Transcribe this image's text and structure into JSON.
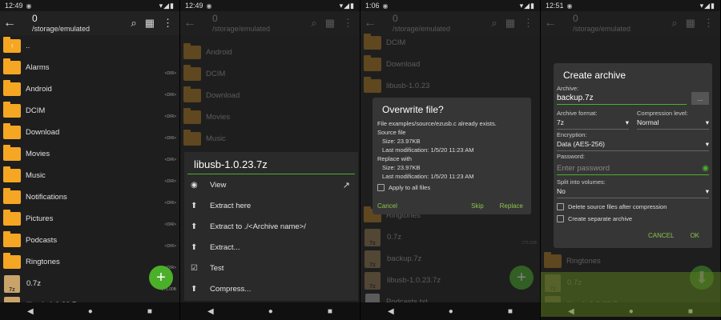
{
  "panels": [
    {
      "status": {
        "time": "12:49"
      },
      "toolbar": {
        "count": "0",
        "path": "/storage/emulated"
      }
    },
    {
      "status": {
        "time": "12:49"
      },
      "toolbar": {
        "count": "0",
        "path": "/storage/emulated"
      }
    },
    {
      "status": {
        "time": "1:06"
      },
      "toolbar": {
        "count": "0",
        "path": "/storage/emulated"
      }
    },
    {
      "status": {
        "time": "12:51"
      },
      "toolbar": {
        "count": "0",
        "path": "/storage/emulated"
      }
    }
  ],
  "panel1": {
    "up_label": "..",
    "rows": [
      {
        "name": "Alarms",
        "meta": "<DIR>",
        "icon": "folder"
      },
      {
        "name": "Android",
        "meta": "<DIR>",
        "icon": "folder"
      },
      {
        "name": "DCIM",
        "meta": "<DIR>",
        "icon": "folder"
      },
      {
        "name": "Download",
        "meta": "<DIR>",
        "icon": "folder"
      },
      {
        "name": "Movies",
        "meta": "<DIR>",
        "icon": "folder"
      },
      {
        "name": "Music",
        "meta": "<DIR>",
        "icon": "folder"
      },
      {
        "name": "Notifications",
        "meta": "<DIR>",
        "icon": "folder"
      },
      {
        "name": "Pictures",
        "meta": "<DIR>",
        "icon": "folder"
      },
      {
        "name": "Podcasts",
        "meta": "<DIR>",
        "icon": "folder"
      },
      {
        "name": "Ringtones",
        "meta": "<DIR>",
        "icon": "folder"
      },
      {
        "name": "0.7z",
        "meta": "275.00B",
        "icon": "7z"
      },
      {
        "name": "libusb-1.0.23.7z",
        "meta": "970.34KB",
        "icon": "7z"
      }
    ],
    "fab": "+"
  },
  "panel2": {
    "rows": [
      "Android",
      "DCIM",
      "Download",
      "Movies",
      "Music"
    ],
    "sheet": {
      "title": "libusb-1.0.23.7z",
      "items": [
        {
          "label": "View",
          "icon": "eye-icon",
          "glyph": "◉"
        },
        {
          "label": "Extract here",
          "icon": "extract-icon",
          "glyph": "⬆"
        },
        {
          "label": "Extract to ./<Archive name>/",
          "icon": "extract-icon",
          "glyph": "⬆"
        },
        {
          "label": "Extract...",
          "icon": "extract-icon",
          "glyph": "⬆"
        },
        {
          "label": "Test",
          "icon": "check-icon",
          "glyph": "☑"
        },
        {
          "label": "Compress...",
          "icon": "compress-icon",
          "glyph": "⬆"
        }
      ],
      "open_external": "↗"
    }
  },
  "panel3": {
    "rows_top": [
      "DCIM",
      "Download",
      "libusb-1.0.23"
    ],
    "rows_bottom": [
      {
        "name": "Ringtones",
        "meta": "",
        "icon": "folder"
      },
      {
        "name": "0.7z",
        "meta": "275.00B",
        "icon": "7z"
      },
      {
        "name": "backup.7z",
        "meta": "",
        "icon": "7z"
      },
      {
        "name": "libusb-1.0.23.7z",
        "meta": "",
        "icon": "7z"
      },
      {
        "name": "Podcasts.txt",
        "meta": "40.00B",
        "icon": "txt"
      }
    ],
    "dialog": {
      "title": "Overwrite file?",
      "message": "File examples/source/ezusb.c already exists.",
      "source_heading": "Source file",
      "source_size": "Size: 23.97KB",
      "source_mod": "Last modification: 1/5/20 11:23 AM",
      "replace_heading": "Replace with",
      "replace_size": "Size: 23.97KB",
      "replace_mod": "Last modification: 1/5/20 11:23 AM",
      "apply_all": "Apply to all files",
      "cancel": "Cancel",
      "skip": "Skip",
      "replace": "Replace"
    }
  },
  "panel4": {
    "rows_bottom": [
      {
        "name": "Ringtones",
        "icon": "folder"
      },
      {
        "name": "0.7z",
        "icon": "7z"
      },
      {
        "name": "libusb-1.0.23.7z",
        "icon": "7z"
      }
    ],
    "dialog": {
      "title": "Create archive",
      "archive_label": "Archive:",
      "archive_value": "backup.7z",
      "browse": "...",
      "format_label": "Archive format:",
      "format_value": "7z",
      "compression_label": "Compression level:",
      "compression_value": "Normal",
      "encryption_label": "Encryption:",
      "encryption_value": "Data (AES-256)",
      "password_label": "Password:",
      "password_placeholder": "Enter password",
      "split_label": "Split into volumes:",
      "split_value": "No",
      "delete_after": "Delete source files after compression",
      "separate": "Create separate archive",
      "cancel": "CANCEL",
      "ok": "OK"
    }
  },
  "colors": {
    "accent": "#4caf2a",
    "folder": "#f5a623",
    "background": "#1e1e1e"
  }
}
